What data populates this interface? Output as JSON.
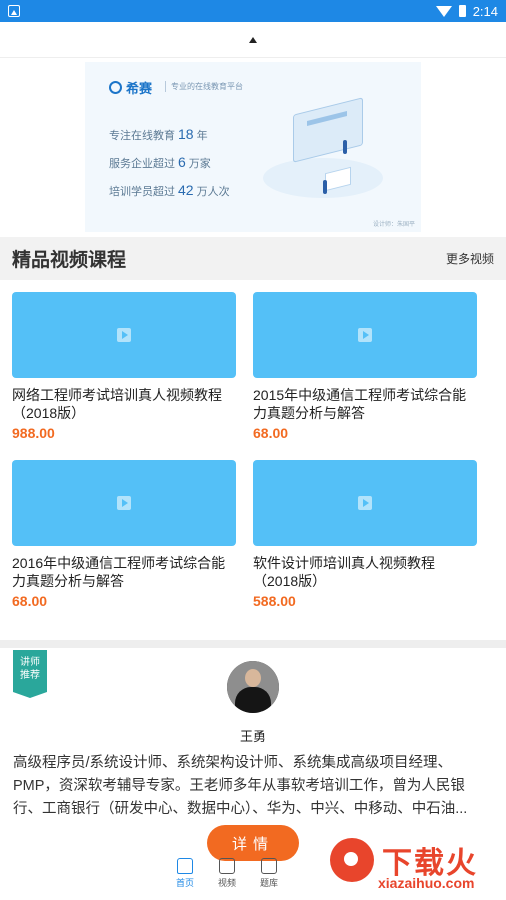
{
  "status_bar": {
    "time": "2:14"
  },
  "banner": {
    "brand": "希赛",
    "tagline": "专业的在线教育平台",
    "stats": [
      {
        "label_before": "专注在线教育",
        "value": "18",
        "label_after": "年"
      },
      {
        "label_before": "服务企业超过",
        "value": "6",
        "label_after": "万家"
      },
      {
        "label_before": "培训学员超过",
        "value": "42",
        "label_after": "万人次"
      }
    ],
    "credit": "设计师：朱国平"
  },
  "section": {
    "title": "精品视频课程",
    "more": "更多视频"
  },
  "courses": [
    {
      "title": "网络工程师考试培训真人视频教程（2018版）",
      "price": "988.00"
    },
    {
      "title": "2015年中级通信工程师考试综合能力真题分析与解答",
      "price": "68.00"
    },
    {
      "title": "2016年中级通信工程师考试综合能力真题分析与解答",
      "price": "68.00"
    },
    {
      "title": "软件设计师培训真人视频教程（2018版）",
      "price": "588.00"
    }
  ],
  "teacher": {
    "ribbon_line1": "讲师",
    "ribbon_line2": "推荐",
    "name": "王勇",
    "bio": "高级程序员/系统设计师、系统架构设计师、系统集成高级项目经理、PMP，资深软考辅导专家。王老师多年从事软考培训工作，曾为人民银行、工商银行（研发中心、数据中心）、华为、中兴、中移动、中石油...",
    "detail_button": "详情"
  },
  "tabs": [
    {
      "label": "首页",
      "icon": "home-icon",
      "active": true
    },
    {
      "label": "视频",
      "icon": "video-icon",
      "active": false
    },
    {
      "label": "题库",
      "icon": "question-bank-icon",
      "active": false
    }
  ],
  "watermark": {
    "text": "下载火",
    "url": "xiazaihuo.com"
  },
  "colors": {
    "accent": "#1e88e5",
    "price": "#f26a21",
    "thumb": "#54c0f7",
    "ribbon": "#2aa79b"
  }
}
